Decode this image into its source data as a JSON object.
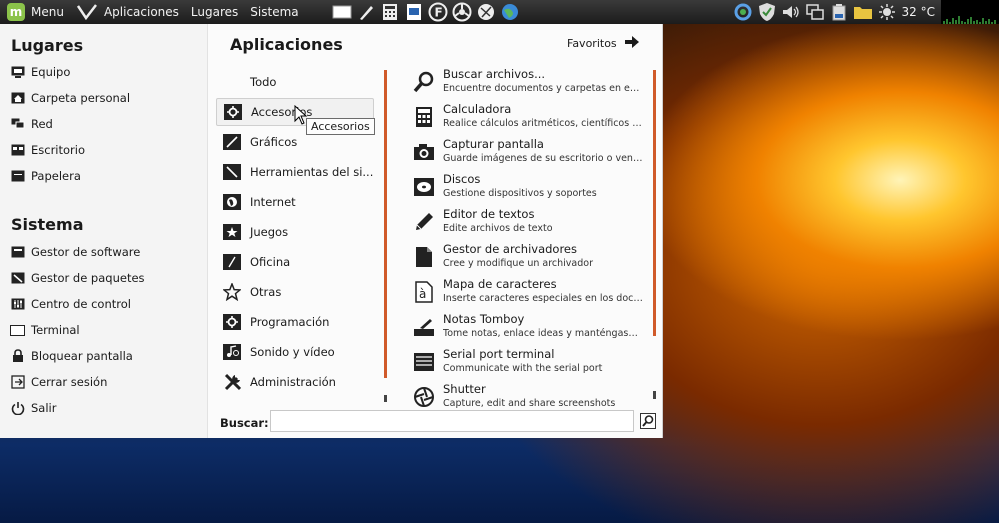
{
  "panel": {
    "menu_label": "Menu",
    "logo_letter": "m",
    "items": [
      "Aplicaciones",
      "Lugares",
      "Sistema"
    ],
    "temperature": "32 °C"
  },
  "places": {
    "title": "Lugares",
    "items": [
      "Equipo",
      "Carpeta personal",
      "Red",
      "Escritorio",
      "Papelera"
    ]
  },
  "system": {
    "title": "Sistema",
    "items": [
      "Gestor de software",
      "Gestor de paquetes",
      "Centro de control",
      "Terminal",
      "Bloquear pantalla",
      "Cerrar sesión",
      "Salir"
    ]
  },
  "applications": {
    "title": "Aplicaciones",
    "favorites_label": "Favoritos",
    "categories": [
      "Todo",
      "Accesorios",
      "Gráficos",
      "Herramientas del si...",
      "Internet",
      "Juegos",
      "Oficina",
      "Otras",
      "Programación",
      "Sonido y vídeo",
      "Administración"
    ],
    "selected_category": "Accesorios",
    "apps": [
      {
        "name": "Buscar archivos...",
        "desc": "Encuentre documentos y carpetas en este ...",
        "icon": "search-icon"
      },
      {
        "name": "Calculadora",
        "desc": "Realice cálculos aritméticos, científicos o fi...",
        "icon": "calculator-icon"
      },
      {
        "name": "Capturar pantalla",
        "desc": "Guarde imágenes de su escritorio o ventan...",
        "icon": "camera-icon"
      },
      {
        "name": "Discos",
        "desc": "Gestione dispositivos y soportes",
        "icon": "disk-icon"
      },
      {
        "name": "Editor de textos",
        "desc": "Edite archivos de texto",
        "icon": "pencil-icon"
      },
      {
        "name": "Gestor de archivadores",
        "desc": "Cree y modifique un archivador",
        "icon": "archive-icon"
      },
      {
        "name": "Mapa de caracteres",
        "desc": "Inserte caracteres especiales en los docum...",
        "icon": "character-map-icon"
      },
      {
        "name": "Notas Tomboy",
        "desc": "Tome notas, enlace ideas y manténgase or...",
        "icon": "notes-icon"
      },
      {
        "name": "Serial port terminal",
        "desc": "Communicate with the serial port",
        "icon": "terminal-icon"
      },
      {
        "name": "Shutter",
        "desc": "Capture, edit and share screenshots",
        "icon": "shutter-icon"
      }
    ]
  },
  "search": {
    "label": "Buscar:",
    "value": "",
    "placeholder": ""
  },
  "tooltip": "Accesorios",
  "colors": {
    "accent": "#d05a2a",
    "panel": "#262626",
    "menu_bg": "#fbfbfb"
  }
}
